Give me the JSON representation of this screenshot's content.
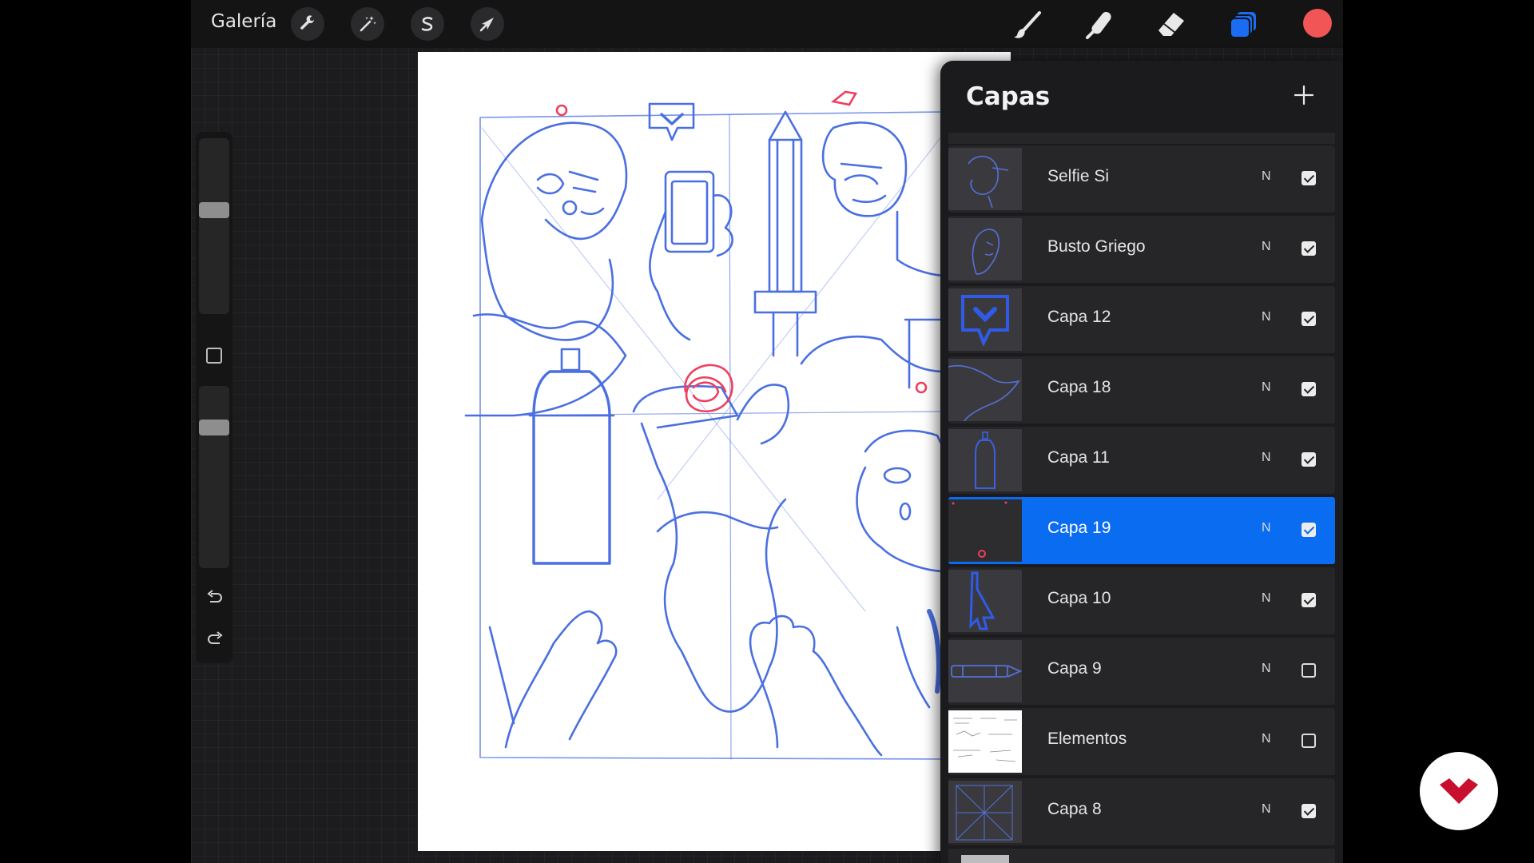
{
  "topbar": {
    "gallery_label": "Galería",
    "actions": [
      {
        "name": "wrench-icon"
      },
      {
        "name": "magic-wand-icon"
      },
      {
        "name": "selection-s-icon"
      },
      {
        "name": "arrow-cursor-icon"
      }
    ],
    "tools": [
      {
        "name": "brush-icon"
      },
      {
        "name": "smudge-icon"
      },
      {
        "name": "eraser-icon"
      },
      {
        "name": "layers-icon",
        "active_color": "#1a6cf2"
      }
    ],
    "active_color": "#f15555"
  },
  "sidebar": {
    "brush_size_level": 0.6,
    "opacity_level": 0.8,
    "undo_icon": "undo-icon",
    "redo_icon": "redo-icon"
  },
  "layers_panel": {
    "title": "Capas",
    "add_icon": "plus-icon",
    "layers": [
      {
        "name": "Selfie Si",
        "blend": "N",
        "visible": true,
        "selected": false
      },
      {
        "name": "Busto Griego",
        "blend": "N",
        "visible": true,
        "selected": false
      },
      {
        "name": "Capa 12",
        "blend": "N",
        "visible": true,
        "selected": false
      },
      {
        "name": "Capa 18",
        "blend": "N",
        "visible": true,
        "selected": false
      },
      {
        "name": "Capa 11",
        "blend": "N",
        "visible": true,
        "selected": false
      },
      {
        "name": "Capa 19",
        "blend": "N",
        "visible": true,
        "selected": true
      },
      {
        "name": "Capa 10",
        "blend": "N",
        "visible": true,
        "selected": false
      },
      {
        "name": "Capa 9",
        "blend": "N",
        "visible": false,
        "selected": false
      },
      {
        "name": "Elementos",
        "blend": "N",
        "visible": false,
        "selected": false
      },
      {
        "name": "Capa 8",
        "blend": "N",
        "visible": true,
        "selected": false
      }
    ]
  },
  "colors": {
    "selection": "#0a6cf0",
    "sketch_blue": "#4a6fe0",
    "sketch_red": "#ee3f5e",
    "brand_red": "#c8102e"
  }
}
